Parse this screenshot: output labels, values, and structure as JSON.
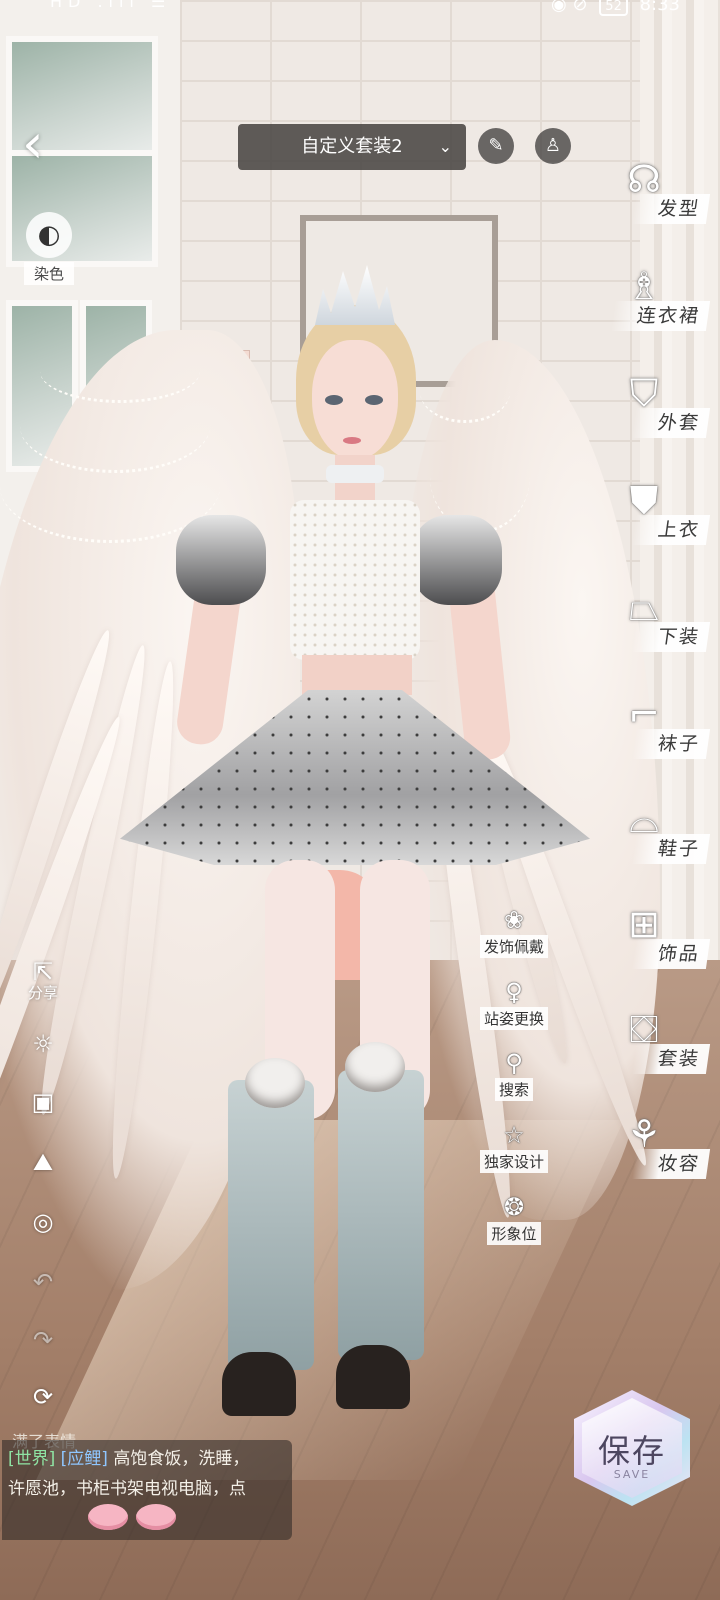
{
  "status_bar": {
    "left": "HD .ıll ☰",
    "battery": "52",
    "time": "8:33"
  },
  "top": {
    "outfit_name": "自定义套装2",
    "chevron": "chevron-down-icon",
    "brush_icon": "brush-icon",
    "dress_icon": "dress-icon"
  },
  "left_panel": {
    "back": "‹",
    "dye_label": "染色"
  },
  "categories": [
    {
      "label": "发型",
      "icon": "hair-icon"
    },
    {
      "label": "连衣裙",
      "icon": "dress-icon"
    },
    {
      "label": "外套",
      "icon": "coat-icon"
    },
    {
      "label": "上衣",
      "icon": "top-icon"
    },
    {
      "label": "下装",
      "icon": "skirt-icon"
    },
    {
      "label": "袜子",
      "icon": "socks-icon"
    },
    {
      "label": "鞋子",
      "icon": "heel-icon"
    },
    {
      "label": "饰品",
      "icon": "bag-icon"
    },
    {
      "label": "套装",
      "icon": "outfit-icon"
    },
    {
      "label": "妆容",
      "icon": "makeup-icon"
    }
  ],
  "left_tools": {
    "share_label": "分享"
  },
  "mid_actions": [
    {
      "label": "发饰佩戴",
      "icon": "hair-accessory-icon"
    },
    {
      "label": "站姿更换",
      "icon": "pose-icon"
    },
    {
      "label": "搜索",
      "icon": "search-icon"
    },
    {
      "label": "独家设计",
      "icon": "star-icon"
    },
    {
      "label": "形象位",
      "icon": "slot-icon"
    }
  ],
  "chat": {
    "top_line": "满了表情",
    "channel": "[世界]",
    "sender": "[应鲤]",
    "message_line1": "高饱食饭，洗睡，",
    "message_line2": "许愿池，书柜书架电视电脑，点"
  },
  "save": {
    "label": "保存",
    "sub": "SAVE"
  }
}
